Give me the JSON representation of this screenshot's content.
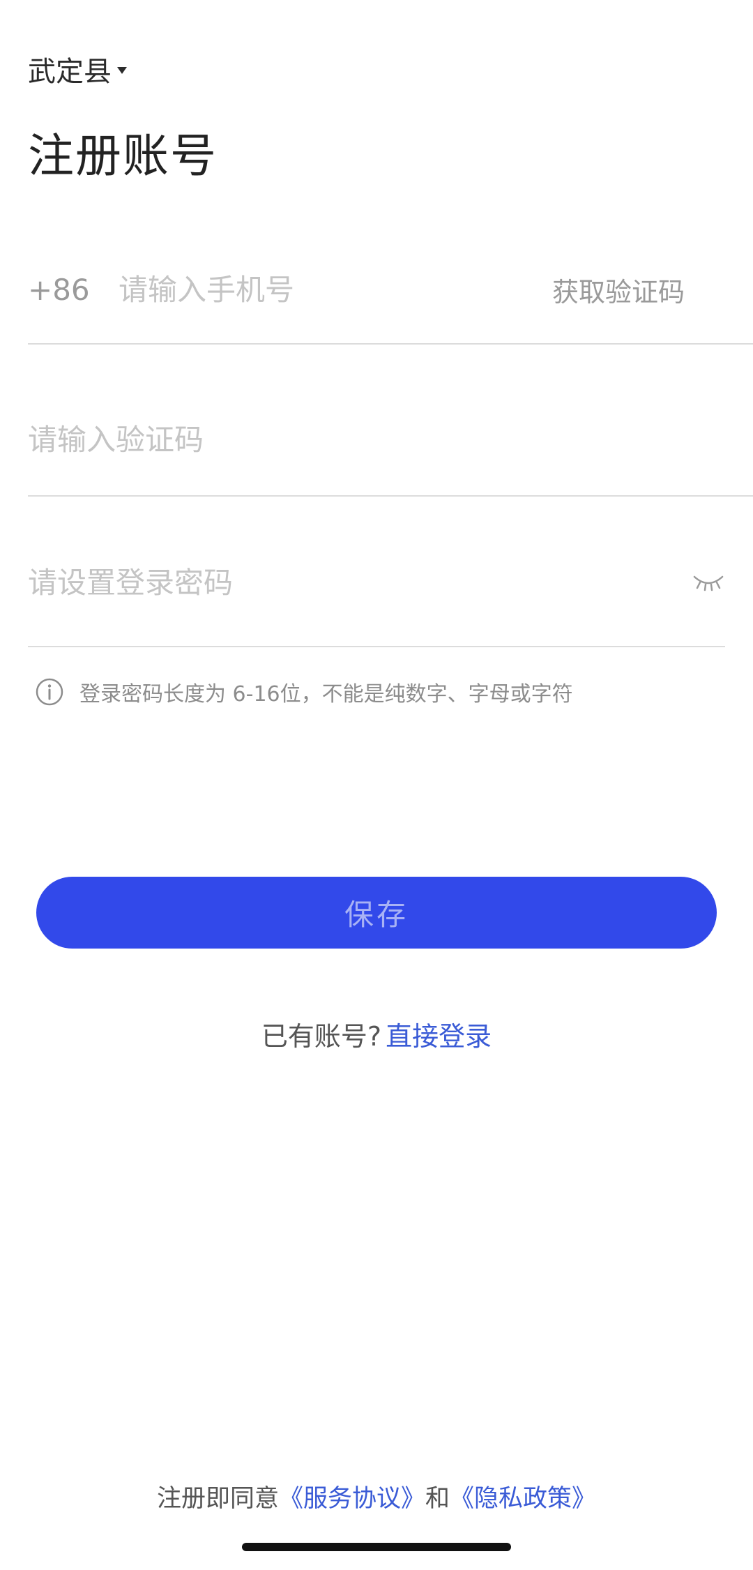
{
  "header": {
    "region": "武定县",
    "title": "注册账号"
  },
  "form": {
    "phone": {
      "prefix": "+86",
      "placeholder": "请输入手机号",
      "value": ""
    },
    "get_code_label": "获取验证码",
    "code": {
      "placeholder": "请输入验证码",
      "value": ""
    },
    "password": {
      "placeholder": "请设置登录密码",
      "value": ""
    },
    "hint": "登录密码长度为 6-16位，不能是纯数字、字母或字符"
  },
  "actions": {
    "save_label": "保存",
    "have_account_text": "已有账号?",
    "login_link": "直接登录"
  },
  "footer": {
    "agree_prefix": "注册即同意",
    "service_link": "《服务协议》",
    "and": "和",
    "privacy_link": "《隐私政策》"
  },
  "colors": {
    "primary": "#3249ea",
    "link": "#3a5bd6"
  }
}
